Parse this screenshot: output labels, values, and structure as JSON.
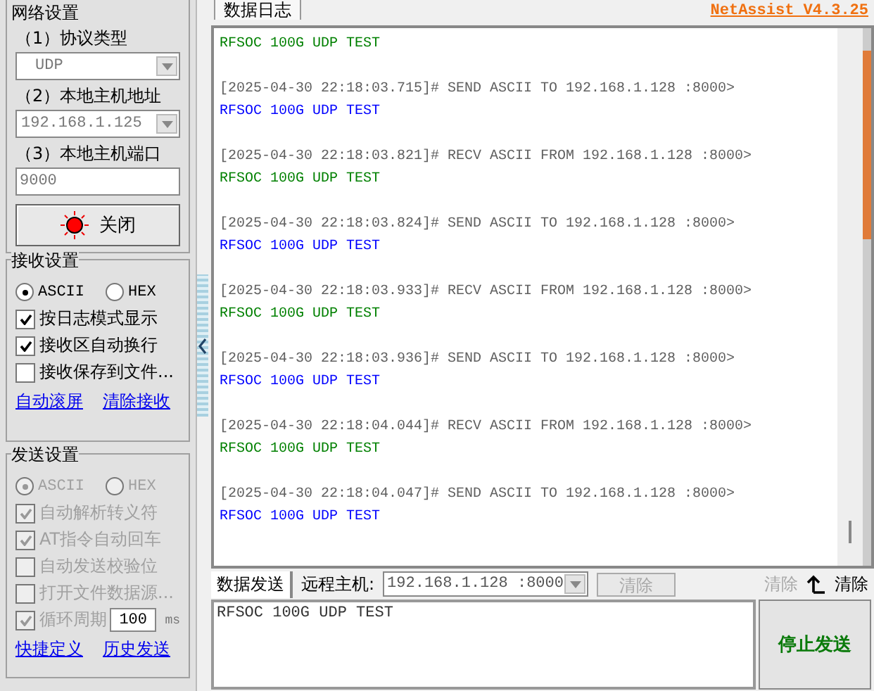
{
  "app_title": "NetAssist V4.3.25",
  "network": {
    "title": "网络设置",
    "protocol_label": "（1）协议类型",
    "protocol": "UDP",
    "host_label": "（2）本地主机地址",
    "host": "192.168.1.125",
    "port_label": "（3）本地主机端口",
    "port": "9000",
    "connect_button": "关闭",
    "connected": true
  },
  "receive": {
    "title": "接收设置",
    "formats": [
      {
        "label": "ASCII",
        "selected": true
      },
      {
        "label": "HEX",
        "selected": false
      }
    ],
    "options": [
      {
        "label": "按日志模式显示",
        "checked": true
      },
      {
        "label": "接收区自动换行",
        "checked": true
      },
      {
        "label": "接收保存到文件...",
        "checked": false
      }
    ],
    "links": [
      "自动滚屏",
      "清除接收"
    ]
  },
  "send": {
    "title": "发送设置",
    "disabled": true,
    "formats": [
      {
        "label": "ASCII",
        "selected": true
      },
      {
        "label": "HEX",
        "selected": false
      }
    ],
    "options": [
      {
        "label": "自动解析转义符",
        "checked": true
      },
      {
        "label": "AT指令自动回车",
        "checked": true
      },
      {
        "label": "自动发送校验位",
        "checked": false
      },
      {
        "label": "打开文件数据源...",
        "checked": false
      }
    ],
    "cycle": {
      "label": "循环周期",
      "checked": true,
      "value": "100",
      "unit": "ms"
    },
    "links": [
      "快捷定义",
      "历史发送"
    ]
  },
  "log_tab": "数据日志",
  "log": [
    {
      "kind": "payload",
      "color": "#008000",
      "text": "RFSOC 100G UDP TEST"
    },
    {
      "kind": "header",
      "text": "[2025-04-30 22:18:03.715]# SEND ASCII TO 192.168.1.128 :8000>"
    },
    {
      "kind": "payload",
      "color": "#0000ff",
      "text": "RFSOC 100G UDP TEST"
    },
    {
      "kind": "header",
      "text": "[2025-04-30 22:18:03.821]# RECV ASCII FROM 192.168.1.128 :8000>"
    },
    {
      "kind": "payload",
      "color": "#008000",
      "text": "RFSOC 100G UDP TEST"
    },
    {
      "kind": "header",
      "text": "[2025-04-30 22:18:03.824]# SEND ASCII TO 192.168.1.128 :8000>"
    },
    {
      "kind": "payload",
      "color": "#0000ff",
      "text": "RFSOC 100G UDP TEST"
    },
    {
      "kind": "header",
      "text": "[2025-04-30 22:18:03.933]# RECV ASCII FROM 192.168.1.128 :8000>"
    },
    {
      "kind": "payload",
      "color": "#008000",
      "text": "RFSOC 100G UDP TEST"
    },
    {
      "kind": "header",
      "text": "[2025-04-30 22:18:03.936]# SEND ASCII TO 192.168.1.128 :8000>"
    },
    {
      "kind": "payload",
      "color": "#0000ff",
      "text": "RFSOC 100G UDP TEST"
    },
    {
      "kind": "header",
      "text": "[2025-04-30 22:18:04.044]# RECV ASCII FROM 192.168.1.128 :8000>"
    },
    {
      "kind": "payload",
      "color": "#008000",
      "text": "RFSOC 100G UDP TEST"
    },
    {
      "kind": "header",
      "text": "[2025-04-30 22:18:04.047]# SEND ASCII TO 192.168.1.128 :8000>"
    },
    {
      "kind": "payload",
      "color": "#0000ff",
      "text": "RFSOC 100G UDP TEST"
    }
  ],
  "send_bar": {
    "tab": "数据发送",
    "remote_label": "远程主机:",
    "remote": "192.168.1.128 :8000",
    "clear_button": "清除",
    "clear_disabled": true,
    "clear_text": "清除",
    "clear_history": "清除"
  },
  "send_text": "RFSOC 100G UDP TEST",
  "stop_button": "停止发送"
}
